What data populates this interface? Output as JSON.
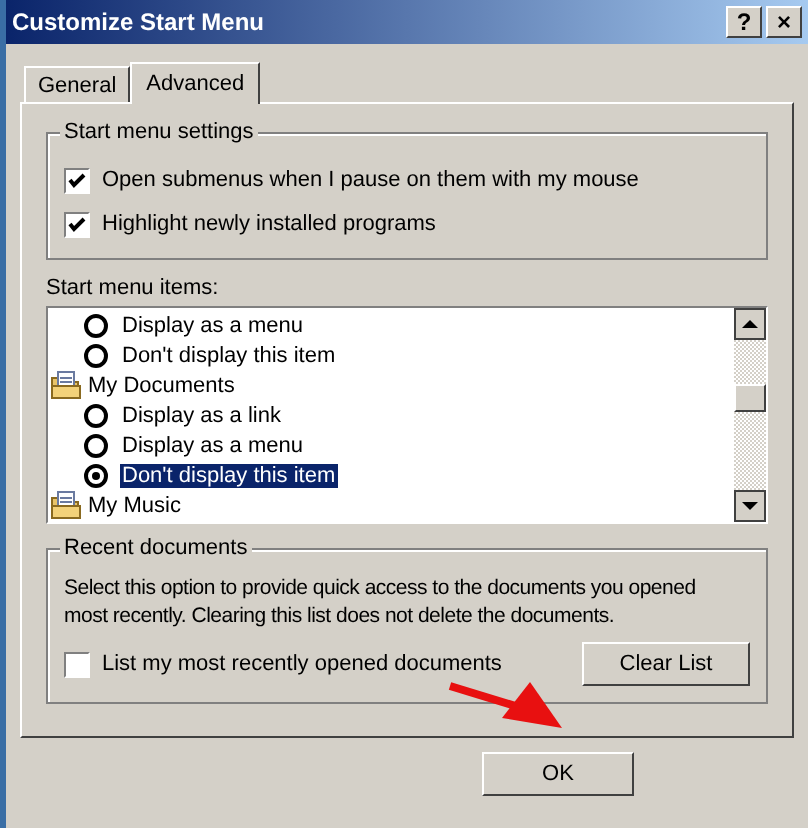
{
  "window": {
    "title": "Customize Start Menu",
    "title_buttons": [
      "?",
      "×"
    ]
  },
  "tabs": [
    {
      "label": "General",
      "selected": false
    },
    {
      "label": "Advanced",
      "selected": true
    }
  ],
  "start_menu_settings": {
    "title": "Start menu settings",
    "options": [
      {
        "label": "Open submenus when I pause on them with my mouse",
        "checked": true
      },
      {
        "label": "Highlight newly installed programs",
        "checked": true
      }
    ]
  },
  "start_menu_items": {
    "label": "Start menu items:",
    "items": [
      {
        "kind": "option",
        "label": "Display as a menu",
        "selected": false
      },
      {
        "kind": "option",
        "label": "Don't display this item",
        "selected": false
      },
      {
        "kind": "folder",
        "label": "My Documents"
      },
      {
        "kind": "option",
        "label": "Display as a link",
        "selected": false
      },
      {
        "kind": "option",
        "label": "Display as a menu",
        "selected": false
      },
      {
        "kind": "option",
        "label": "Don't display this item",
        "selected": true
      },
      {
        "kind": "folder",
        "label": "My Music"
      }
    ]
  },
  "recent_documents": {
    "title": "Recent documents",
    "description": "Select this option to provide quick access to the documents you opened most recently.  Clearing this list does not delete the documents.",
    "option": {
      "label": "List my most recently opened documents",
      "checked": false
    },
    "button": "Clear List"
  },
  "buttons": [
    "OK"
  ]
}
